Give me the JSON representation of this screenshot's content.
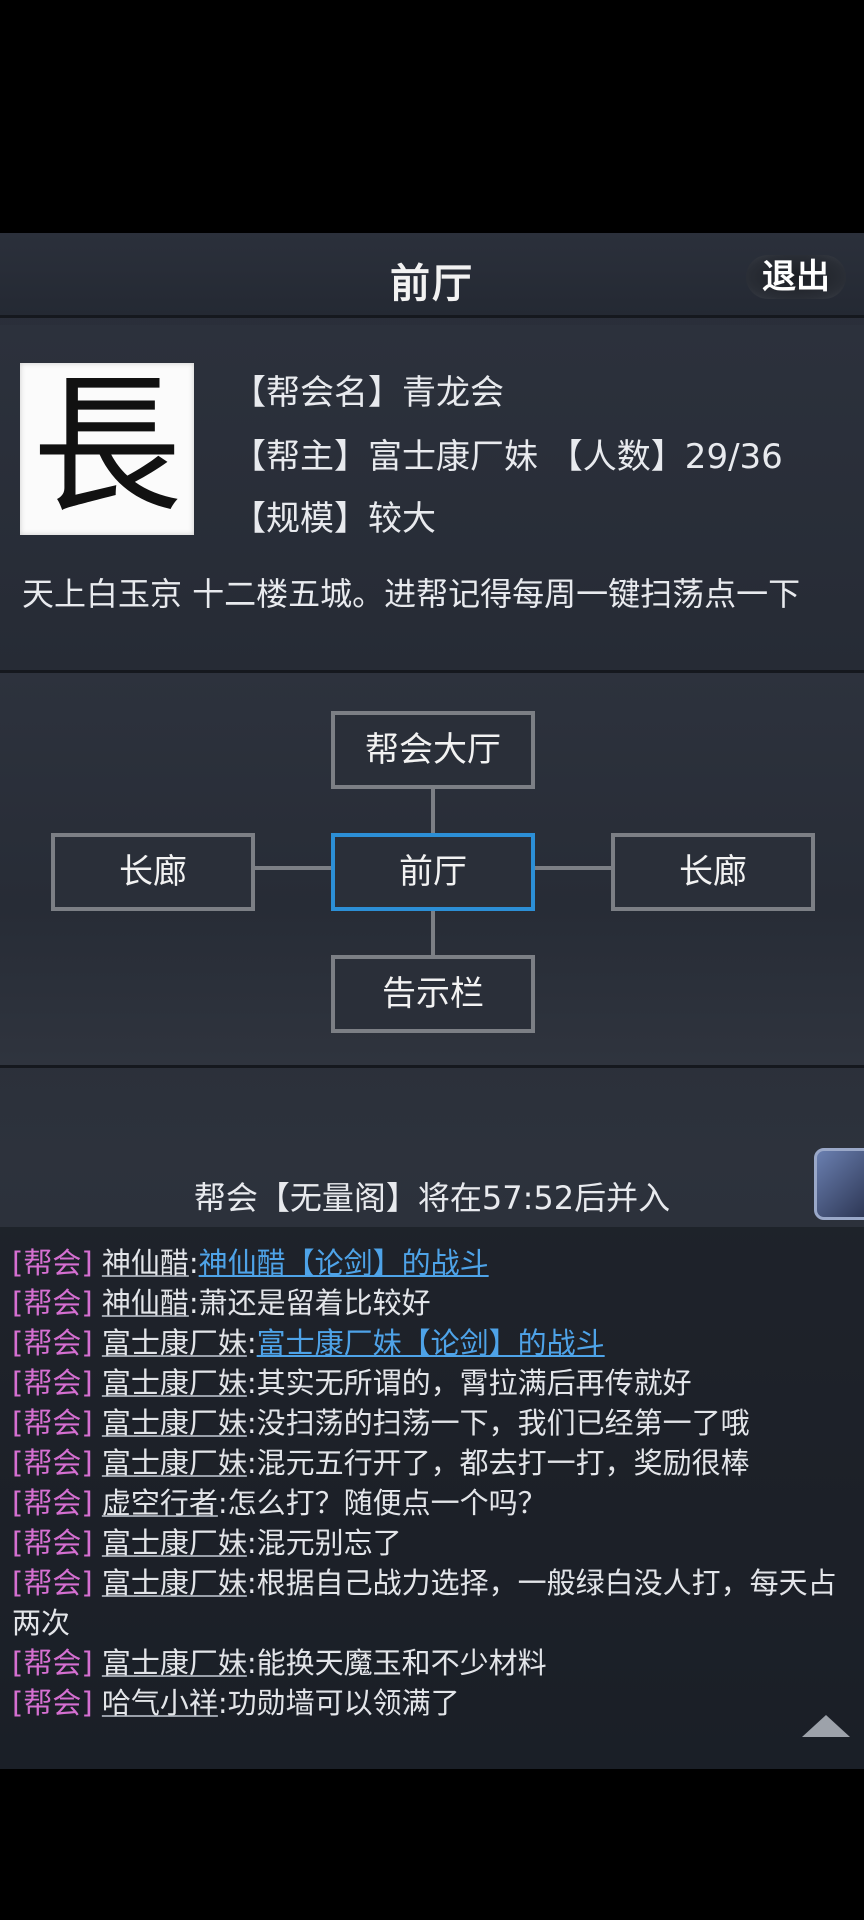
{
  "header": {
    "title": "前厅",
    "exit_label": "退出"
  },
  "guild": {
    "emblem_char": "長",
    "name_line": "【帮会名】青龙会",
    "leader_line": "【帮主】富士康厂妹 【人数】29/36",
    "scale_line": "【规模】较大",
    "description": "天上白玉京 十二楼五城。进帮记得每周一键扫荡点一下"
  },
  "map": {
    "top": "帮会大厅",
    "left": "长廊",
    "center": "前厅",
    "right": "长廊",
    "bottom": "告示栏"
  },
  "notice": "帮会【无量阁】将在57:52后并入",
  "chat": {
    "messages": [
      {
        "tag": "[帮会]",
        "name": "神仙醋",
        "sep": ":",
        "link": "神仙醋【论剑】的战斗",
        "text": ""
      },
      {
        "tag": "[帮会]",
        "name": "神仙醋",
        "sep": ":",
        "link": "",
        "text": "萧还是留着比较好"
      },
      {
        "tag": "[帮会]",
        "name": "富士康厂妹",
        "sep": ":",
        "link": "富士康厂妹【论剑】的战斗",
        "text": ""
      },
      {
        "tag": "[帮会]",
        "name": "富士康厂妹",
        "sep": ":",
        "link": "",
        "text": "其实无所谓的，霄拉满后再传就好"
      },
      {
        "tag": "[帮会]",
        "name": "富士康厂妹",
        "sep": ":",
        "link": "",
        "text": "没扫荡的扫荡一下，我们已经第一了哦"
      },
      {
        "tag": "[帮会]",
        "name": "富士康厂妹",
        "sep": ":",
        "link": "",
        "text": "混元五行开了，都去打一打，奖励很棒"
      },
      {
        "tag": "[帮会]",
        "name": "虚空行者",
        "sep": ":",
        "link": "",
        "text": "怎么打？随便点一个吗？"
      },
      {
        "tag": "[帮会]",
        "name": "富士康厂妹",
        "sep": ":",
        "link": "",
        "text": "混元别忘了"
      },
      {
        "tag": "[帮会]",
        "name": "富士康厂妹",
        "sep": ":",
        "link": "",
        "text": "根据自己战力选择，一般绿白没人打，每天占"
      },
      {
        "tag": "",
        "name": "",
        "sep": "",
        "link": "",
        "text": "两次"
      },
      {
        "tag": "[帮会]",
        "name": "富士康厂妹",
        "sep": ":",
        "link": "",
        "text": "能换天魔玉和不少材料"
      },
      {
        "tag": "[帮会]",
        "name": "哈气小祥",
        "sep": ":",
        "link": "",
        "text": "功勋墙可以领满了"
      }
    ]
  },
  "colors": {
    "accent": "#2c8fd6",
    "guild_tag": "#d56fd1",
    "link": "#4ea3e8"
  },
  "icons": {
    "scroll": "triangle-up-icon",
    "side_badge": "book-icon"
  }
}
